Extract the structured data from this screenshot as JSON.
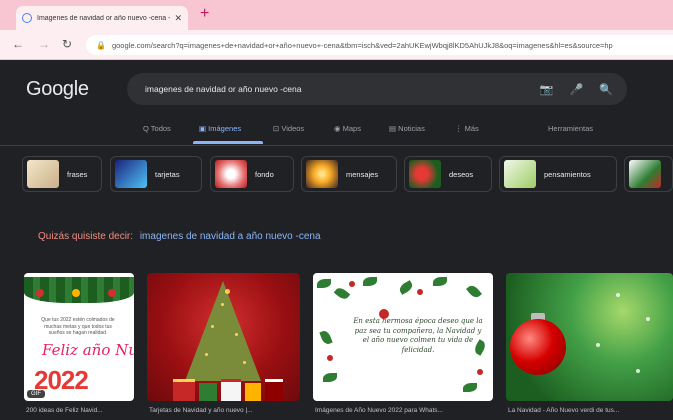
{
  "browser": {
    "tab_title": "Imagenes de navidad or año nuevo -cena - Buscar con Google",
    "tab_close": "✕",
    "new_tab": "+",
    "back": "←",
    "forward": "→",
    "reload": "↻",
    "lock": "🔒",
    "url": "google.com/search?q=imagenes+de+navidad+or+año+nuevo+-cena&tbm=isch&ved=2ahUKEwjWbqj8lKD5AhUJkJ8&oq=imagenes&hl=es&source=hp"
  },
  "google": {
    "logo": "Google",
    "query": "imagenes de navidad or año nuevo -cena",
    "camera_icon": "📷",
    "mic_icon": "🎤",
    "search_icon": "🔍",
    "tabs": [
      {
        "label": "Q  Todos"
      },
      {
        "label": "Imágenes"
      },
      {
        "label": "Videos"
      },
      {
        "label": "Maps"
      },
      {
        "label": "Noticias"
      },
      {
        "label": "⋮ Más"
      },
      {
        "label": "Herramientas"
      }
    ]
  },
  "chips": [
    {
      "label": "frases"
    },
    {
      "label": "tarjetas"
    },
    {
      "label": "fondo"
    },
    {
      "label": "mensajes"
    },
    {
      "label": "deseos"
    },
    {
      "label": "pensamientos"
    }
  ],
  "did_you_mean": {
    "prefix": "Quizás quisiste decir:",
    "suggestion": "imagenes de navidad a año nuevo -cena"
  },
  "results": [
    {
      "caption": "200 ideas de Feliz Navid...",
      "card_text": "Que tus 2022 estén colmados de muchas metas y que todos tus sueños se hagan realidad.",
      "card_title": "Feliz año Nuevo",
      "year": "2022",
      "badge": "GIF"
    },
    {
      "caption": "Tarjetas de Navidad y año nuevo |..."
    },
    {
      "caption": "Imágenes de Año Nuevo 2022 para Whats...",
      "poem": "En esta hermosa época deseo que la paz sea tu compañera, la Navidad y el año nuevo colmen tu vida de felicidad."
    },
    {
      "caption": "La Navidad - Año Nuevo verdi de tus..."
    }
  ],
  "colors": {
    "background": "#202124",
    "link_blue": "#8ab4f8",
    "did_you_mean_red": "#f28b82"
  }
}
